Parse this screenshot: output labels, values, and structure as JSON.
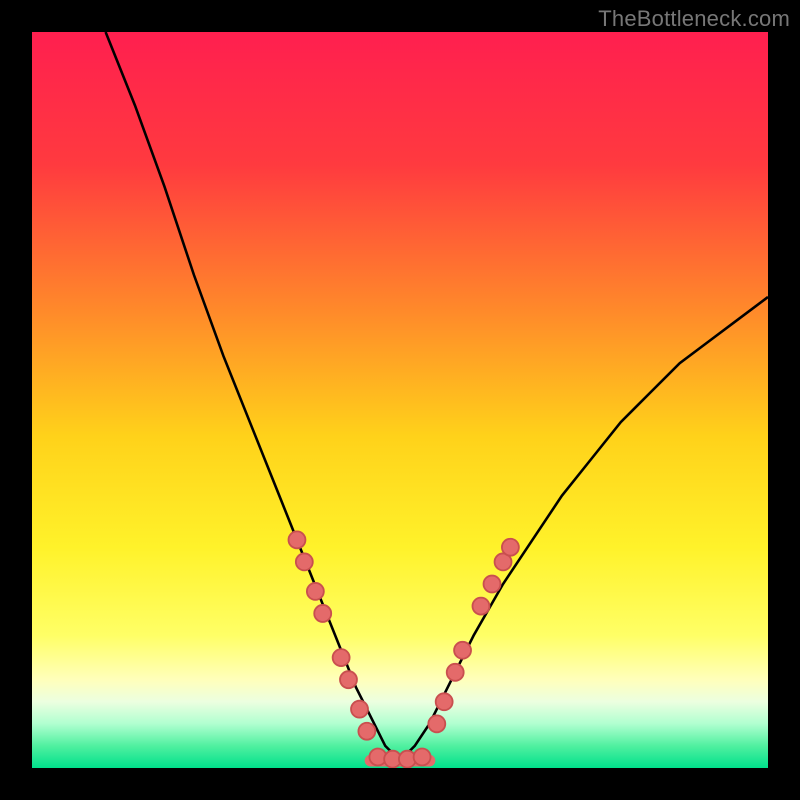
{
  "attribution": "TheBottleneck.com",
  "colors": {
    "black": "#000000",
    "curve": "#000000",
    "marker_fill": "#e46a6a",
    "marker_stroke": "#c94f4f",
    "gradient_stops": [
      {
        "offset": 0.0,
        "color": "#ff1f4f"
      },
      {
        "offset": 0.18,
        "color": "#ff3a3f"
      },
      {
        "offset": 0.38,
        "color": "#ff8a2a"
      },
      {
        "offset": 0.55,
        "color": "#ffd21a"
      },
      {
        "offset": 0.7,
        "color": "#fff22a"
      },
      {
        "offset": 0.82,
        "color": "#ffff66"
      },
      {
        "offset": 0.88,
        "color": "#ffffbb"
      },
      {
        "offset": 0.91,
        "color": "#ecffe0"
      },
      {
        "offset": 0.94,
        "color": "#b0ffd0"
      },
      {
        "offset": 0.97,
        "color": "#50f0a0"
      },
      {
        "offset": 1.0,
        "color": "#00e08b"
      }
    ]
  },
  "chart_data": {
    "type": "line",
    "title": "",
    "xlabel": "",
    "ylabel": "",
    "xlim": [
      0,
      100
    ],
    "ylim": [
      0,
      100
    ],
    "grid": false,
    "legend": false,
    "series": [
      {
        "name": "left-curve",
        "x": [
          10,
          14,
          18,
          22,
          26,
          30,
          32,
          34,
          36,
          38,
          40,
          42,
          44,
          46,
          48,
          50
        ],
        "y": [
          100,
          90,
          79,
          67,
          56,
          46,
          41,
          36,
          31,
          26,
          21,
          16,
          11,
          7,
          3,
          1
        ]
      },
      {
        "name": "right-curve",
        "x": [
          50,
          52,
          54,
          56,
          58,
          60,
          64,
          68,
          72,
          76,
          80,
          84,
          88,
          92,
          96,
          100
        ],
        "y": [
          1,
          3,
          6,
          10,
          14,
          18,
          25,
          31,
          37,
          42,
          47,
          51,
          55,
          58,
          61,
          64
        ]
      }
    ],
    "flat_bottom": {
      "x": [
        46,
        54
      ],
      "y": 1
    },
    "markers": [
      {
        "series": "left-curve",
        "x": 36.0,
        "y": 31
      },
      {
        "series": "left-curve",
        "x": 37.0,
        "y": 28
      },
      {
        "series": "left-curve",
        "x": 38.5,
        "y": 24
      },
      {
        "series": "left-curve",
        "x": 39.5,
        "y": 21
      },
      {
        "series": "left-curve",
        "x": 42.0,
        "y": 15
      },
      {
        "series": "left-curve",
        "x": 43.0,
        "y": 12
      },
      {
        "series": "left-curve",
        "x": 44.5,
        "y": 8
      },
      {
        "series": "left-curve",
        "x": 45.5,
        "y": 5
      },
      {
        "series": "flat-bottom",
        "x": 47.0,
        "y": 1.5
      },
      {
        "series": "flat-bottom",
        "x": 49.0,
        "y": 1.2
      },
      {
        "series": "flat-bottom",
        "x": 51.0,
        "y": 1.2
      },
      {
        "series": "flat-bottom",
        "x": 53.0,
        "y": 1.5
      },
      {
        "series": "right-curve",
        "x": 55.0,
        "y": 6
      },
      {
        "series": "right-curve",
        "x": 56.0,
        "y": 9
      },
      {
        "series": "right-curve",
        "x": 57.5,
        "y": 13
      },
      {
        "series": "right-curve",
        "x": 58.5,
        "y": 16
      },
      {
        "series": "right-curve",
        "x": 61.0,
        "y": 22
      },
      {
        "series": "right-curve",
        "x": 62.5,
        "y": 25
      },
      {
        "series": "right-curve",
        "x": 64.0,
        "y": 28
      },
      {
        "series": "right-curve",
        "x": 65.0,
        "y": 30
      }
    ]
  }
}
